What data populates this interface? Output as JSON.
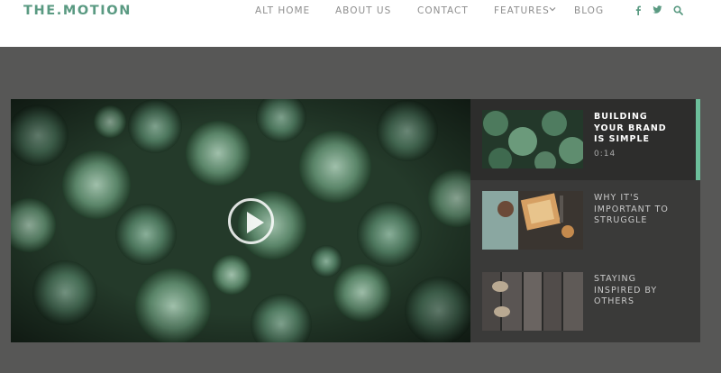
{
  "site": {
    "logo": "THE.MOTION",
    "brand_color": "#5a9a82"
  },
  "nav": {
    "items": [
      {
        "label": "ALT HOME"
      },
      {
        "label": "ABOUT US"
      },
      {
        "label": "CONTACT"
      },
      {
        "label": "FEATURES",
        "has_dropdown": true
      },
      {
        "label": "BLOG"
      }
    ],
    "social_icons": [
      "facebook-icon",
      "twitter-icon",
      "search-icon"
    ],
    "dropdown_icon": "chevron-down-icon"
  },
  "player": {
    "play_icon": "play-icon",
    "accent_color": "#6cbf9b"
  },
  "playlist": {
    "items": [
      {
        "title_lines": [
          "BUILDING",
          "YOUR BRAND",
          "IS SIMPLE"
        ],
        "duration": "0:14",
        "active": true
      },
      {
        "title_lines": [
          "WHY IT'S",
          "IMPORTANT TO",
          "STRUGGLE"
        ],
        "duration": "",
        "active": false
      },
      {
        "title_lines": [
          "STAYING",
          "INSPIRED BY",
          "OTHERS"
        ],
        "duration": "",
        "active": false
      }
    ]
  }
}
